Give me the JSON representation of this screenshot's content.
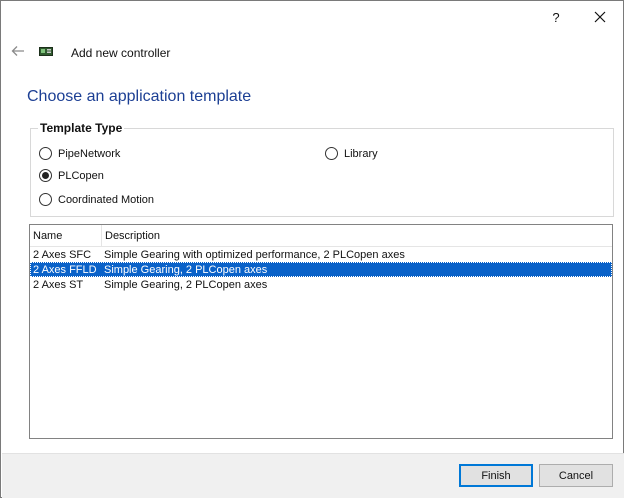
{
  "titlebar": {
    "help_label": "?"
  },
  "header": {
    "title": "Add new controller"
  },
  "page": {
    "heading": "Choose an application template"
  },
  "template_type": {
    "label": "Template Type",
    "options": [
      {
        "label": "PipeNetwork",
        "selected": false
      },
      {
        "label": "Library",
        "selected": false
      },
      {
        "label": "PLCopen",
        "selected": true
      },
      {
        "label": "Coordinated Motion",
        "selected": false
      }
    ]
  },
  "templates": {
    "columns": [
      "Name",
      "Description"
    ],
    "rows": [
      {
        "name": "2 Axes SFC",
        "description": "Simple Gearing with optimized performance, 2 PLCopen axes",
        "selected": false
      },
      {
        "name": "2 Axes FFLD",
        "description": "Simple Gearing, 2 PLCopen axes",
        "selected": true
      },
      {
        "name": "2 Axes ST",
        "description": "Simple Gearing, 2 PLCopen axes",
        "selected": false
      }
    ]
  },
  "footer": {
    "finish_label": "Finish",
    "cancel_label": "Cancel"
  },
  "colors": {
    "heading": "#1c3f94",
    "selection": "#0a62c9",
    "default_button_border": "#0078d7"
  }
}
